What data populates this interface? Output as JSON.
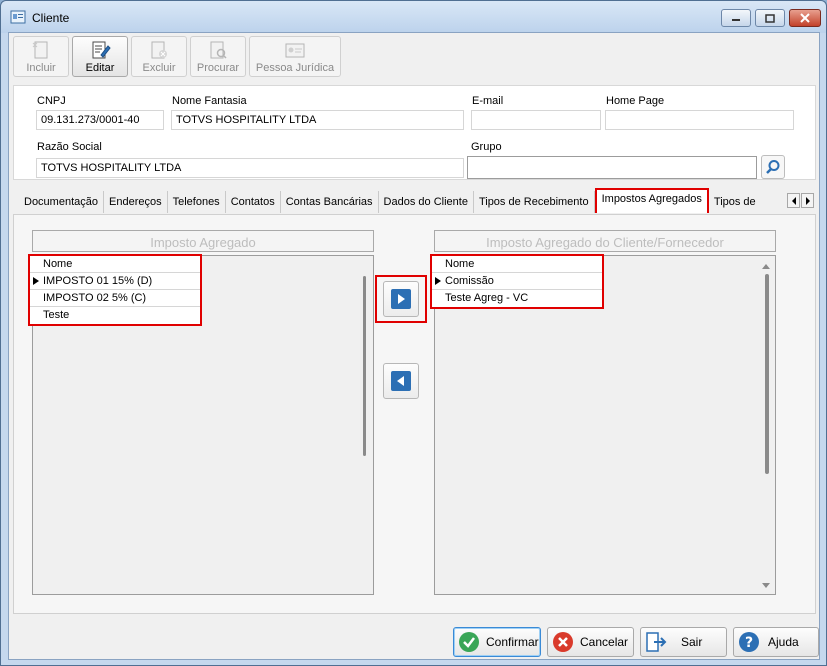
{
  "window": {
    "title": "Cliente"
  },
  "toolbar": {
    "incluir": "Incluir",
    "editar": "Editar",
    "excluir": "Excluir",
    "procurar": "Procurar",
    "pessoa_juridica": "Pessoa Jurídica"
  },
  "form": {
    "cnpj_label": "CNPJ",
    "cnpj_value": "09.131.273/0001-40",
    "nome_fantasia_label": "Nome Fantasia",
    "nome_fantasia_value": "TOTVS HOSPITALITY LTDA",
    "email_label": "E-mail",
    "email_value": "",
    "home_page_label": "Home Page",
    "home_page_value": "",
    "razao_social_label": "Razão Social",
    "razao_social_value": "TOTVS HOSPITALITY LTDA",
    "grupo_label": "Grupo",
    "grupo_value": ""
  },
  "tabs": [
    {
      "label": "Documentação"
    },
    {
      "label": "Endereços"
    },
    {
      "label": "Telefones"
    },
    {
      "label": "Contatos"
    },
    {
      "label": "Contas Bancárias"
    },
    {
      "label": "Dados do Cliente"
    },
    {
      "label": "Tipos de Recebimento"
    },
    {
      "label": "Impostos Agregados"
    },
    {
      "label": "Tipos de"
    }
  ],
  "left_panel": {
    "header": "Imposto Agregado",
    "column": "Nome",
    "rows": [
      "IMPOSTO 01 15% (D)",
      "IMPOSTO 02 5% (C)",
      "Teste"
    ]
  },
  "right_panel": {
    "header": "Imposto Agregado do Cliente/Fornecedor",
    "column": "Nome",
    "rows": [
      "Comissão",
      "Teste Agreg - VC"
    ]
  },
  "footer": {
    "confirmar": "Confirmar",
    "cancelar": "Cancelar",
    "sair": "Sair",
    "ajuda": "Ajuda"
  },
  "colors": {
    "highlight": "#e00000",
    "accent": "#2c6fb4"
  }
}
